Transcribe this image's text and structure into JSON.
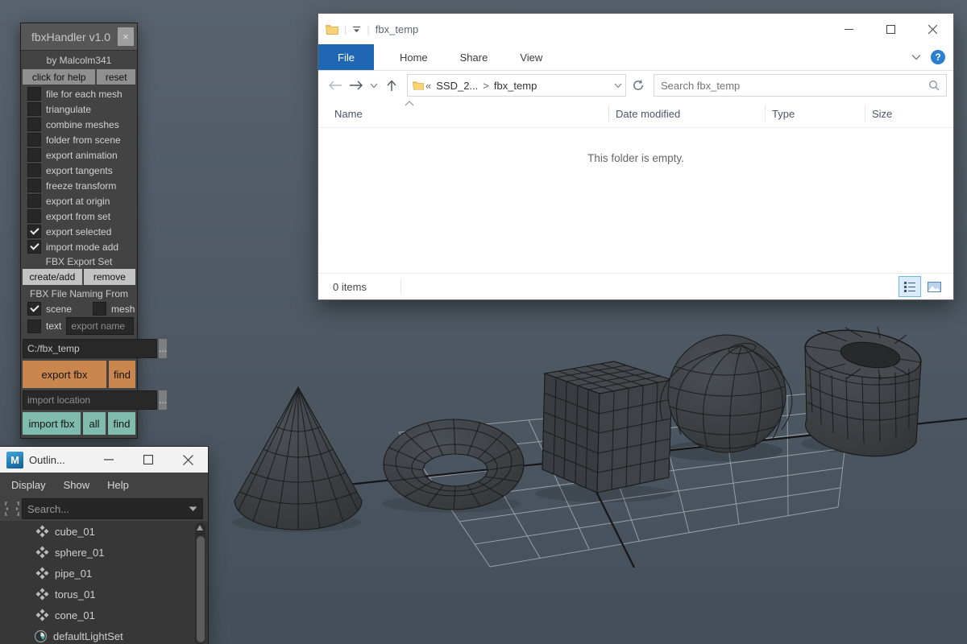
{
  "viewport": {
    "objects": [
      "cone",
      "torus",
      "cube",
      "sphere",
      "pipe"
    ],
    "bg_top": "#57626c",
    "bg_bottom": "#454f59"
  },
  "fbx": {
    "title": "fbxHandler v1.0",
    "close": "×",
    "byline": "by Malcolm341",
    "help": "click for help",
    "reset": "reset",
    "checks": [
      {
        "label": "file for each mesh",
        "checked": false
      },
      {
        "label": "triangulate",
        "checked": false
      },
      {
        "label": "combine meshes",
        "checked": false
      },
      {
        "label": "folder from scene",
        "checked": false
      },
      {
        "label": "export animation",
        "checked": false
      },
      {
        "label": "export tangents",
        "checked": false
      },
      {
        "label": "freeze transform",
        "checked": false
      },
      {
        "label": "export at origin",
        "checked": false
      },
      {
        "label": "export from set",
        "checked": false
      },
      {
        "label": "export selected",
        "checked": true
      },
      {
        "label": "import mode add",
        "checked": true
      }
    ],
    "export_set_label": "FBX Export Set",
    "create_add": "create/add",
    "remove": "remove",
    "naming_label": "FBX File Naming From",
    "scene": {
      "label": "scene",
      "checked": true
    },
    "mesh": {
      "label": "mesh",
      "checked": false
    },
    "text": {
      "label": "text",
      "checked": false
    },
    "export_name_placeholder": "export name",
    "export_path": "C:/fbx_temp",
    "browse": "...",
    "export_fbx": "export fbx",
    "find": "find",
    "import_location_placeholder": "import location",
    "import_fbx": "import fbx",
    "all": "all",
    "colors": {
      "orange": "#c9874e",
      "teal": "#7fbcae"
    }
  },
  "explorer": {
    "title": "fbx_temp",
    "tabs": [
      "File",
      "Home",
      "Share",
      "View"
    ],
    "address": {
      "prefix": "«",
      "drive": "SSD_2...",
      "sep": ">",
      "folder": "fbx_temp"
    },
    "search_placeholder": "Search fbx_temp",
    "columns": [
      "Name",
      "Date modified",
      "Type",
      "Size"
    ],
    "empty": "This folder is empty.",
    "status": "0 items",
    "help": "?"
  },
  "outliner": {
    "title": "Outlin...",
    "menus": [
      "Display",
      "Show",
      "Help"
    ],
    "search_placeholder": "Search...",
    "items": [
      {
        "name": "cube_01",
        "icon": "mesh"
      },
      {
        "name": "sphere_01",
        "icon": "mesh"
      },
      {
        "name": "pipe_01",
        "icon": "mesh"
      },
      {
        "name": "torus_01",
        "icon": "mesh"
      },
      {
        "name": "cone_01",
        "icon": "mesh"
      },
      {
        "name": "defaultLightSet",
        "icon": "lightset"
      }
    ]
  }
}
